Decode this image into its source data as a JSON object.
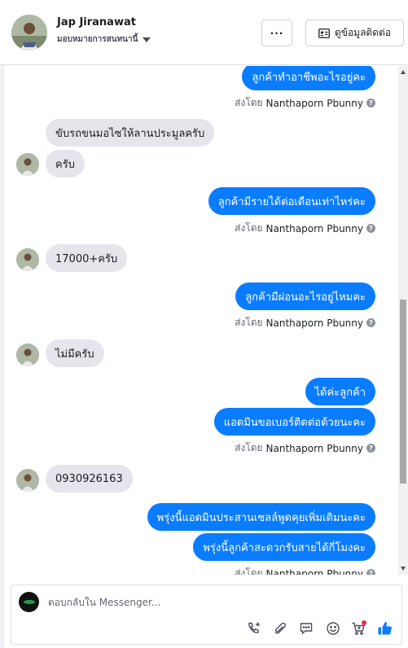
{
  "header": {
    "name": "Jap Jiranawat",
    "subtitle": "มอบหมายการสนทนานี้",
    "more_label": "···",
    "contact_label": "ดูข้อมูลติดต่อ"
  },
  "messages": {
    "out_1": "ลูกค้าทำอาชีพอะไรอยู่คะ",
    "sent_1_prefix": "ส่งโดย",
    "sent_1_name": "Nanthaporn Pbunny",
    "in_1": "ขับรถขนมอไซให้ลานประมูลครับ",
    "in_2": "ครับ",
    "out_2": "ลูกค้ามีรายได้ต่อเดือนเท่าไหร่คะ",
    "sent_2_prefix": "ส่งโดย",
    "sent_2_name": "Nanthaporn Pbunny",
    "in_3": "17000+ครับ",
    "out_3": "ลูกค้ามีผ่อนอะไรอยู่ไหมคะ",
    "sent_3_prefix": "ส่งโดย",
    "sent_3_name": "Nanthaporn Pbunny",
    "in_4": "ไม่มีครับ",
    "out_4": "ได้ค่ะลูกค้า",
    "out_5": "แอดมินขอเบอร์ติดต่อด้วยนะคะ",
    "sent_4_prefix": "ส่งโดย",
    "sent_4_name": "Nanthaporn Pbunny",
    "in_5": "0930926163",
    "out_6": "พรุ่งนี้แอดมินประสานเซลล์พูดคุยเพิ่มเติมนะคะ",
    "out_7": "พรุ่งนี้ลูกค้าสะดวกรับสายได้กี่โมงคะ",
    "sent_5_prefix": "ส่งโดย",
    "sent_5_name": "Nanthaporn Pbunny"
  },
  "composer": {
    "placeholder": "ตอบกลับใน Messenger..."
  },
  "colors": {
    "outgoing_bubble": "#0a7cff",
    "incoming_bubble": "#e4e6eb",
    "like_icon": "#0a7cff",
    "notification_dot": "#f02849"
  },
  "icons": [
    "more-icon",
    "contact-card-icon",
    "caret-down-icon",
    "help-icon",
    "add-call-icon",
    "attach-icon",
    "saved-reply-icon",
    "emoji-icon",
    "cart-icon",
    "like-icon"
  ]
}
